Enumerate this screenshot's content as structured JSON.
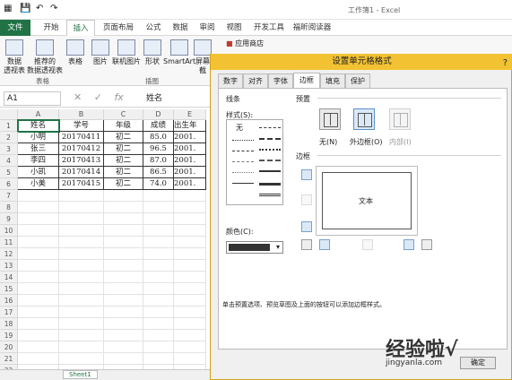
{
  "window": {
    "title": "工作簿1 - Excel"
  },
  "ribbon_tabs": [
    "文件",
    "开始",
    "插入",
    "页面布局",
    "公式",
    "数据",
    "审阅",
    "视图",
    "开发工具",
    "福昕阅读器"
  ],
  "active_tab": "插入",
  "ribbon": {
    "buttons": [
      "数据\n透视表",
      "推荐的\n数据透视表",
      "表格",
      "图片",
      "联机图片",
      "形状",
      "SmartArt",
      "屏幕截"
    ],
    "groups": [
      "表格",
      "插图"
    ],
    "apps_label": "应用商店"
  },
  "formula_bar": {
    "name_box": "A1",
    "cancel": "✕",
    "enter": "✓",
    "fx": "fx",
    "value": "姓名"
  },
  "spreadsheet": {
    "columns": [
      "A",
      "B",
      "C",
      "D",
      "E"
    ],
    "rows": [
      "1",
      "2",
      "3",
      "4",
      "5",
      "6",
      "7",
      "8",
      "9",
      "10",
      "11",
      "12",
      "13",
      "14",
      "15",
      "16",
      "17",
      "18",
      "19",
      "20",
      "21",
      "22"
    ],
    "table": [
      [
        "姓名",
        "学号",
        "年级",
        "成绩",
        "出生年"
      ],
      [
        "小明",
        "20170411",
        "初二",
        "85.0",
        "2001."
      ],
      [
        "张三",
        "20170412",
        "初二",
        "96.5",
        "2001."
      ],
      [
        "李四",
        "20170413",
        "初二",
        "87.0",
        "2001."
      ],
      [
        "小凯",
        "20170414",
        "初二",
        "86.5",
        "2001."
      ],
      [
        "小美",
        "20170415",
        "初二",
        "74.0",
        "2001."
      ]
    ],
    "sheet_tab": "Sheet1"
  },
  "dialog": {
    "title": "设置单元格格式",
    "help": "?",
    "tabs": [
      "数字",
      "对齐",
      "字体",
      "边框",
      "填充",
      "保护"
    ],
    "active_tab": "边框",
    "line_section": "线条",
    "style_label": "样式(S):",
    "none_style": "无",
    "color_label": "颜色(C):",
    "preset_section": "预置",
    "presets": [
      "无(N)",
      "外边框(O)",
      "内部(I)"
    ],
    "border_section": "边框",
    "preview_text": "文本",
    "hint": "单击预置选项、预览草图及上面的按钮可以添加边框样式。",
    "ok_label": "确定"
  },
  "watermark": {
    "text": "经验啦√",
    "url": "jingyanla.com"
  }
}
